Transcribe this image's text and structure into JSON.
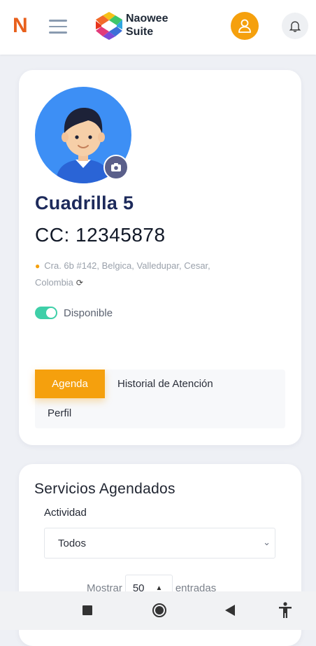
{
  "header": {
    "app_letter": "N",
    "brand_line1": "Naowee",
    "brand_line2": "Suite"
  },
  "profile": {
    "name": "Cuadrilla 5",
    "id_text": "CC: 12345878",
    "address": "Cra. 6b #142, Belgica, Valledupar, Cesar, Colombia",
    "status_label": "Disponible",
    "status_on": true,
    "tabs": [
      {
        "label": "Agenda",
        "active": true
      },
      {
        "label": "Historial de Atención",
        "active": false
      },
      {
        "label": "Perfil",
        "active": false
      }
    ]
  },
  "services": {
    "title": "Servicios Agendados",
    "activity_label": "Actividad",
    "activity_value": "Todos",
    "show_prefix": "Mostrar",
    "show_value": "50",
    "show_suffix": "entradas"
  },
  "colors": {
    "accent": "#f5a00d",
    "brand_orange": "#e8601c",
    "title_navy": "#1d2a5b",
    "toggle_green": "#3ecfa8",
    "avatar_blue": "#3d8ff5"
  },
  "icons": [
    "menu-icon",
    "user-icon",
    "bell-icon",
    "camera-icon",
    "location-pin-icon",
    "refresh-icon",
    "chevron-down-icon",
    "square-icon",
    "circle-icon",
    "back-triangle-icon",
    "accessibility-icon"
  ]
}
